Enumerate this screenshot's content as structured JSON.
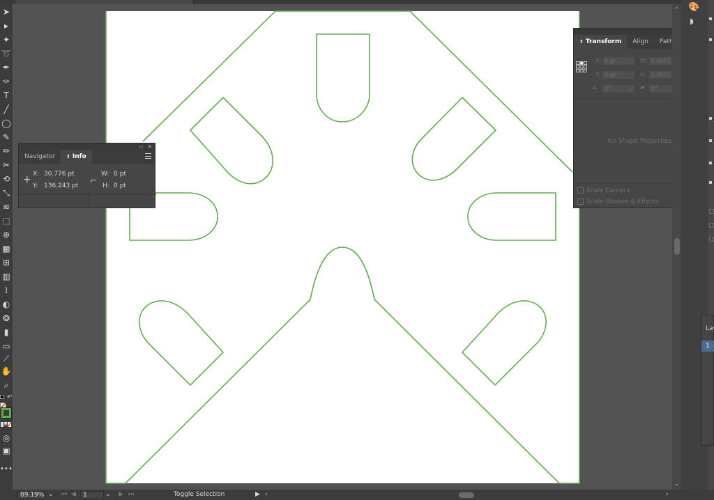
{
  "navigator_info_panel": {
    "tabs": [
      {
        "label": "Navigator"
      },
      {
        "label": "Info"
      }
    ],
    "x_label": "X:",
    "x_value": "30.776 pt",
    "y_label": "Y:",
    "y_value": "136.243 pt",
    "w_label": "W:",
    "w_value": "0 pt",
    "h_label": "H:",
    "h_value": "0 pt"
  },
  "transform_panel": {
    "tabs": [
      {
        "label": "Transform"
      },
      {
        "label": "Align"
      },
      {
        "label": "Pathfinder"
      }
    ],
    "x_label": "X:",
    "x_value": "0 pt",
    "y_label": "Y:",
    "y_value": "0 pt",
    "w_label": "W:",
    "w_value": "0.0001 pt",
    "h_label": "H:",
    "h_value": "0.0001 pt",
    "rotate_value": "0°",
    "shear_value": "0°",
    "no_shape_text": "No Shape Properties",
    "scale_corners_label": "Scale Corners",
    "scale_strokes_label": "Scale Strokes & Effects"
  },
  "statusbar": {
    "zoom_value": "89.19%",
    "artboard_number": "1",
    "status_text": "Toggle Selection"
  },
  "right_dock": {
    "layers_tab_label": "Lay",
    "layer_row_number": "1"
  },
  "colors": {
    "outline_stroke": "#5bb246",
    "artboard_fill": "#ffffff",
    "pasteboard": "#535353",
    "panel_bg": "#464646",
    "stroke_swatch": "#5bb246"
  },
  "icons": [
    "selection-tool-icon",
    "direct-selection-tool-icon",
    "magic-wand-icon",
    "lasso-icon",
    "pen-tool-icon",
    "type-tool-icon",
    "line-tool-icon",
    "ellipse-tool-icon",
    "paintbrush-icon",
    "pencil-icon",
    "scissors-icon",
    "rotate-icon",
    "scale-icon",
    "warp-icon",
    "free-transform-icon",
    "shape-builder-icon",
    "perspective-grid-icon",
    "mesh-icon",
    "gradient-icon",
    "eyedropper-icon",
    "blend-icon",
    "symbol-sprayer-icon",
    "column-graph-icon",
    "artboard-tool-icon",
    "slice-icon",
    "hand-tool-icon",
    "zoom-tool-icon"
  ]
}
